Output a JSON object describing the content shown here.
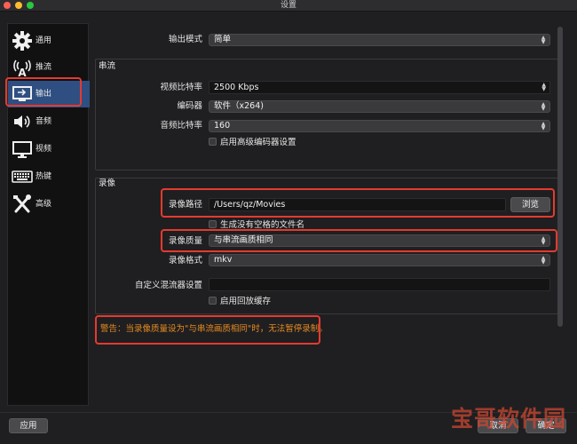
{
  "window": {
    "title": "设置"
  },
  "sidebar": {
    "items": [
      {
        "label": "通用",
        "icon": "gear-icon"
      },
      {
        "label": "推流",
        "icon": "broadcast-antenna-icon"
      },
      {
        "label": "输出",
        "icon": "output-monitor-icon"
      },
      {
        "label": "音频",
        "icon": "speaker-icon"
      },
      {
        "label": "视频",
        "icon": "monitor-icon"
      },
      {
        "label": "热键",
        "icon": "keyboard-icon"
      },
      {
        "label": "高级",
        "icon": "tools-icon"
      }
    ],
    "active_index": 2
  },
  "output_mode": {
    "label": "输出模式",
    "value": "简单"
  },
  "streaming": {
    "title": "串流",
    "video_bitrate": {
      "label": "视频比特率",
      "value": "2500 Kbps"
    },
    "encoder": {
      "label": "编码器",
      "value": "软件（x264)"
    },
    "audio_bitrate": {
      "label": "音频比特率",
      "value": "160"
    },
    "advanced_encoder_checkbox": "启用高级编码器设置"
  },
  "recording": {
    "title": "录像",
    "path": {
      "label": "录像路径",
      "value": "/Users/qz/Movies",
      "browse_label": "浏览"
    },
    "no_space_checkbox": "生成没有空格的文件名",
    "quality": {
      "label": "录像质量",
      "value": "与串流画质相同"
    },
    "format": {
      "label": "录像格式",
      "value": "mkv"
    },
    "muxer": {
      "label": "自定义混流器设置",
      "value": ""
    },
    "replay_buffer_checkbox": "启用回放缓存"
  },
  "warning": "警告：当录像质量设为\"与串流画质相同\"时，无法暂停录制。",
  "footer": {
    "apply_label": "应用",
    "ok_label": "取消",
    "cancel_label": "确定"
  },
  "watermark": "宝哥软件园",
  "colors": {
    "active_nav": "#2f4f82",
    "highlight_box": "#e53a2f",
    "warning_text": "#e58a20"
  }
}
